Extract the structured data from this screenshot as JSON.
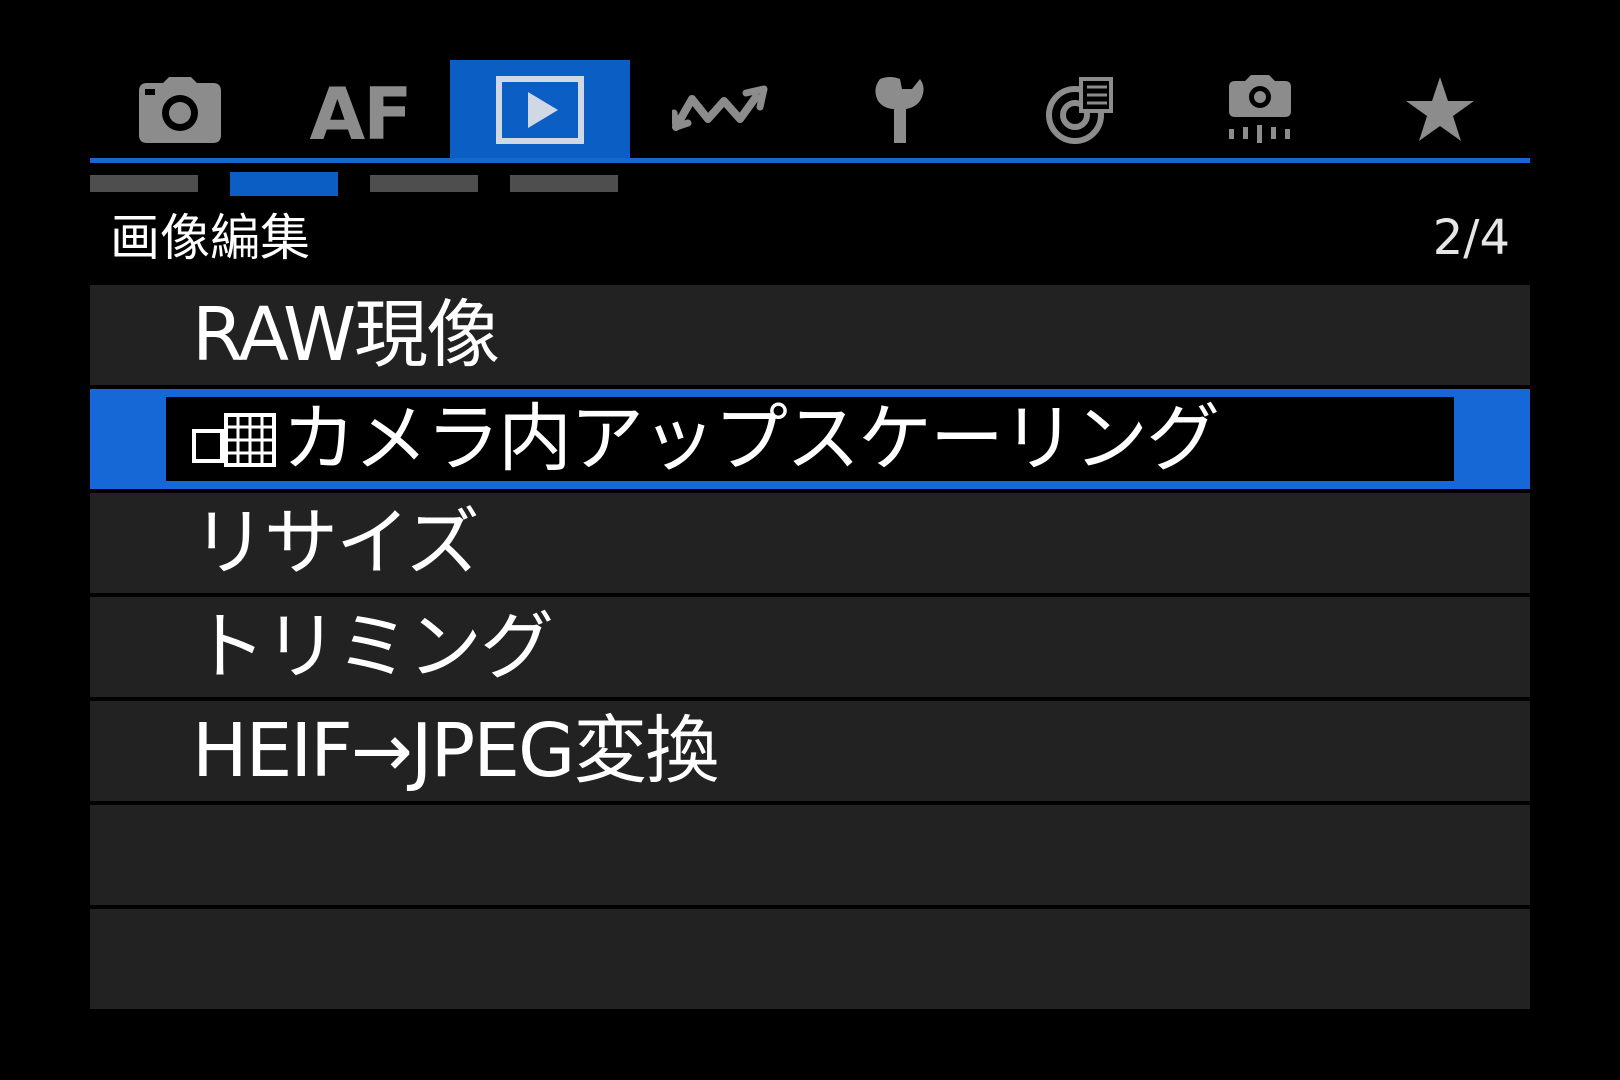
{
  "tabs": [
    {
      "id": "shooting",
      "icon": "camera-icon"
    },
    {
      "id": "af",
      "label": "AF"
    },
    {
      "id": "playback",
      "icon": "play-icon",
      "active": true
    },
    {
      "id": "network",
      "icon": "network-wave-icon"
    },
    {
      "id": "setup",
      "icon": "wrench-icon"
    },
    {
      "id": "custom-functions",
      "icon": "custom-function-icon"
    },
    {
      "id": "custom-shooting",
      "icon": "camera-custom-icon"
    },
    {
      "id": "my-menu",
      "icon": "star-icon"
    }
  ],
  "page_indicator": {
    "count": 4,
    "active_index": 1
  },
  "section": {
    "title": "画像編集",
    "page_counter": "2/4"
  },
  "menu": {
    "items": [
      {
        "label": "RAW現像"
      },
      {
        "label": "カメラ内アップスケーリング",
        "selected": true,
        "badge_icon": "upscale-badge-icon"
      },
      {
        "label": "リサイズ"
      },
      {
        "label": "トリミング"
      },
      {
        "label": "HEIF→JPEG変換"
      },
      {
        "label": ""
      },
      {
        "label": ""
      }
    ]
  },
  "colors": {
    "accent": "#1668d6",
    "tab_active_bg": "#0a5ec4",
    "row_bg": "#222222",
    "icon_gray": "#8c8c8c"
  }
}
